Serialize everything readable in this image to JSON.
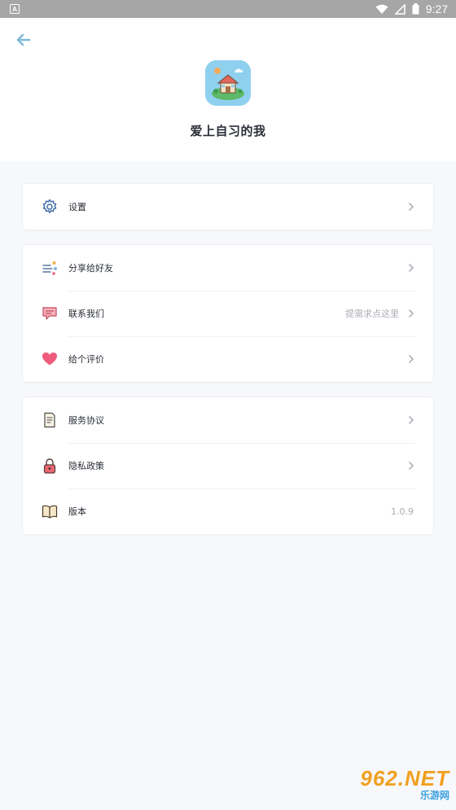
{
  "status_bar": {
    "left_badge": "A",
    "time": "9:27"
  },
  "header": {
    "back_icon": "arrow-left-icon",
    "app_icon": "house-app-icon",
    "title": "爱上自习的我"
  },
  "groups": [
    {
      "items": [
        {
          "icon": "gear-icon",
          "label": "设置",
          "extra": ""
        }
      ]
    },
    {
      "items": [
        {
          "icon": "share-icon",
          "label": "分享给好友",
          "extra": ""
        },
        {
          "icon": "chat-bubble-icon",
          "label": "联系我们",
          "extra": "提需求点这里"
        },
        {
          "icon": "heart-icon",
          "label": "给个评价",
          "extra": ""
        }
      ]
    },
    {
      "items": [
        {
          "icon": "document-icon",
          "label": "服务协议",
          "extra": ""
        },
        {
          "icon": "lock-icon",
          "label": "隐私政策",
          "extra": ""
        },
        {
          "icon": "book-icon",
          "label": "版本",
          "extra": "1.0.9"
        }
      ]
    }
  ],
  "watermark": {
    "top": "962.NET",
    "bottom": "乐游网"
  },
  "colors": {
    "accent": "#7fb8d8",
    "background": "#f7f8fb",
    "heart": "#ee5b7c",
    "lock": "#e8676f"
  }
}
